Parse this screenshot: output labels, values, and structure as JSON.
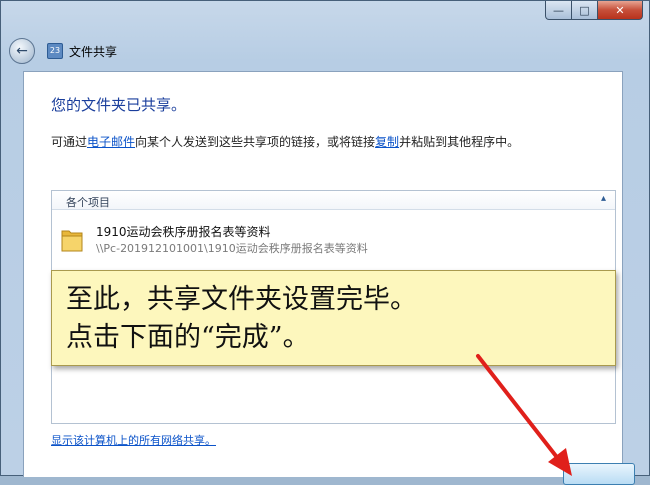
{
  "window": {
    "title": "文件共享",
    "caption_buttons": {
      "minimize": "—",
      "maximize": "□",
      "close": "✕"
    }
  },
  "nav": {
    "back_icon": "arrow-left-icon",
    "app_icon_text": "23"
  },
  "content": {
    "heading": "您的文件夹已共享。",
    "desc_prefix": "可通过",
    "desc_link_email": "电子邮件",
    "desc_middle": "向某个人发送到这些共享项的链接，或将链接",
    "desc_link_copy": "复制",
    "desc_suffix": "并粘贴到其他程序中。",
    "items_header": "各个项目",
    "items": [
      {
        "name": "1910运动会秩序册报名表等资料",
        "path": "\\\\Pc-201912101001\\1910运动会秩序册报名表等资料"
      }
    ],
    "network_link": "显示该计算机上的所有网络共享。"
  },
  "annotation": {
    "line1": "至此，共享文件夹设置完毕。",
    "line2": "点击下面的“完成”。"
  },
  "colors": {
    "link": "#0b53c9",
    "heading": "#1a3e9c",
    "note_bg": "#fdf7bd",
    "arrow": "#e0201b"
  }
}
